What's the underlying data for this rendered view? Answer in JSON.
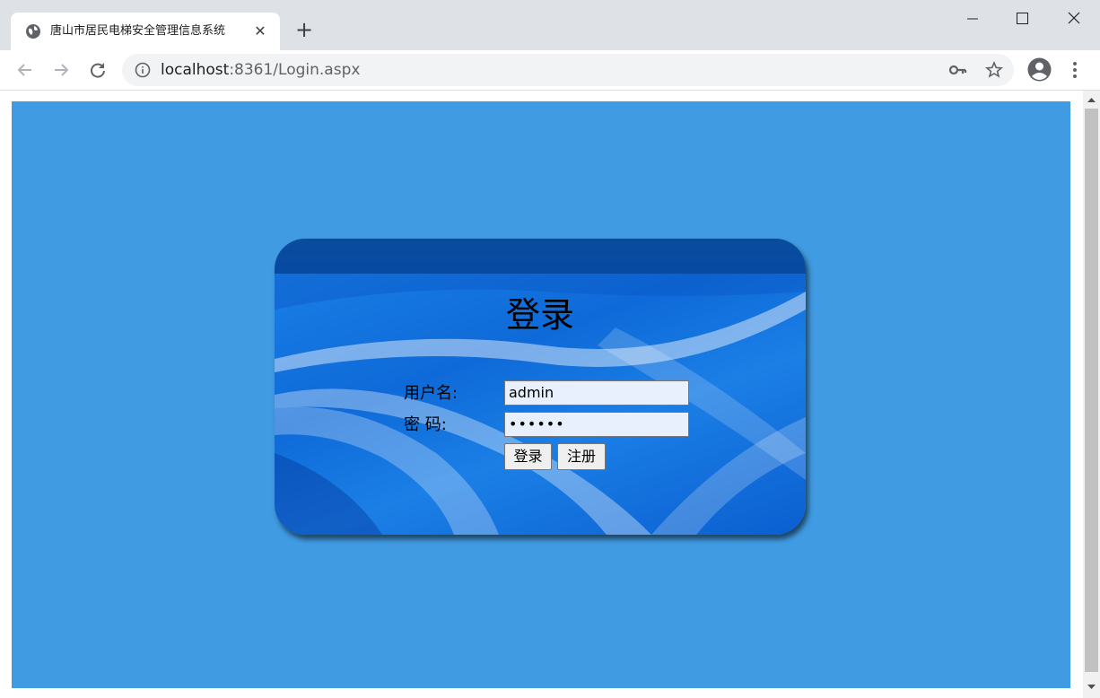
{
  "browser": {
    "tab_title": "唐山市居民电梯安全管理信息系统",
    "tab_close_glyph": "✕",
    "new_tab_glyph": "+",
    "url_host": "localhost",
    "url_rest": ":8361/Login.aspx",
    "icons": [
      "globe-icon",
      "close-icon",
      "plus-icon",
      "minimize-icon",
      "maximize-icon",
      "window-close-icon",
      "back-arrow-icon",
      "forward-arrow-icon",
      "reload-icon",
      "info-icon",
      "key-icon",
      "star-icon",
      "profile-icon",
      "kebab-menu-icon"
    ]
  },
  "page": {
    "background_color": "#409be2",
    "card_header_color": "#064aa2"
  },
  "login": {
    "title": "登录",
    "username_label": "用户名:",
    "password_label": "密  码:",
    "username_value": "admin",
    "password_value": "••••••",
    "login_button": "登录",
    "register_button": "注册"
  }
}
